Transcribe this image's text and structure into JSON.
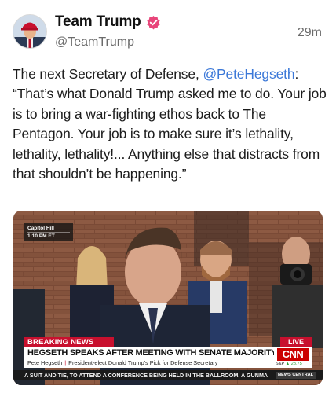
{
  "post": {
    "display_name": "Team Trump",
    "handle": "@TeamTrump",
    "time_ago": "29m",
    "text_part1": "The next Secretary of Defense, ",
    "mention": "@PeteHegseth",
    "text_part2": ": “That’s what Donald Trump asked me to do. Your job is to bring a war-fighting ethos back to The Pentagon. Your job is to make sure it’s lethality, lethality, lethality!... Anything else that distracts from that shouldn’t be happening.”"
  },
  "media": {
    "location": "Capitol Hill",
    "clock": "1:10 PM ET",
    "breaking_label": "BREAKING NEWS",
    "live_label": "LIVE",
    "headline": "HEGSETH SPEAKS AFTER MEETING WITH SENATE MAJORITY LEADER",
    "sub_name": "Pete Hegseth",
    "sub_desc": "President-elect Donald Trump's Pick for Defense Secretary",
    "network": "CNN",
    "ticker_index": "S&P",
    "ticker_change": "▲ 23.75",
    "crawl": "A SUIT AND TIE, TO ATTEND A CONFERENCE BEING HELD IN THE BALLROOM. A GUNMA",
    "crawl_tag": "NEWS CENTRAL"
  },
  "colors": {
    "accent_red": "#c8102e",
    "mention_blue": "#3b78d8",
    "verified_pink": "#e8457a"
  },
  "icons": {
    "verified": "verified-badge-icon"
  }
}
